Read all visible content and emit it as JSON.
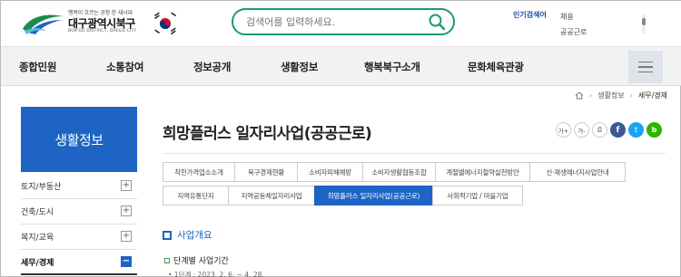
{
  "header": {
    "logo_slogan": "행복이 흐르는 공정 한 새시대",
    "logo_name": "대구광역시북구",
    "logo_en": "BUK-GU DISTRICT, DAEGU CITY",
    "search_placeholder": "검색어를 입력하세요.",
    "popular_label": "인기검색어",
    "popular_items": [
      "채용",
      "공공근로"
    ]
  },
  "nav": {
    "items": [
      "종합민원",
      "소통참여",
      "정보공개",
      "생활정보",
      "행복북구소개",
      "문화체육관광"
    ]
  },
  "breadcrumb": {
    "items": [
      "생활정보",
      "세무/경제"
    ]
  },
  "sidebar": {
    "title": "생활정보",
    "items": [
      "토지/부동산",
      "건축/도시",
      "복지/교육",
      "세무/경제"
    ]
  },
  "content": {
    "title": "희망플러스 일자리사업(공공근로)",
    "tools": {
      "font_up": "가+",
      "font_down": "가-",
      "print": "⎙",
      "facebook": "f",
      "twitter": "t",
      "blog": "b"
    },
    "tabs_row1": [
      "착한가격업소소개",
      "북구경제현황",
      "소비자피해예방",
      "소비자생활협동조합",
      "계절별에너지절약실천방안",
      "신·재생에너지사업안내"
    ],
    "tabs_row2": [
      "지역유통단지",
      "지역공동체일자리사업",
      "희망플러스 일자리사업(공공근로)",
      "사회적기업 / 마을기업"
    ],
    "section_title": "사업개요",
    "sub_title": "단계별 사업기간",
    "detail": "• 1단계 : 2023. 2. 6. ~ 4. 28."
  },
  "colors": {
    "accent": "#1d64c4",
    "search_border": "#1a9c6d"
  }
}
